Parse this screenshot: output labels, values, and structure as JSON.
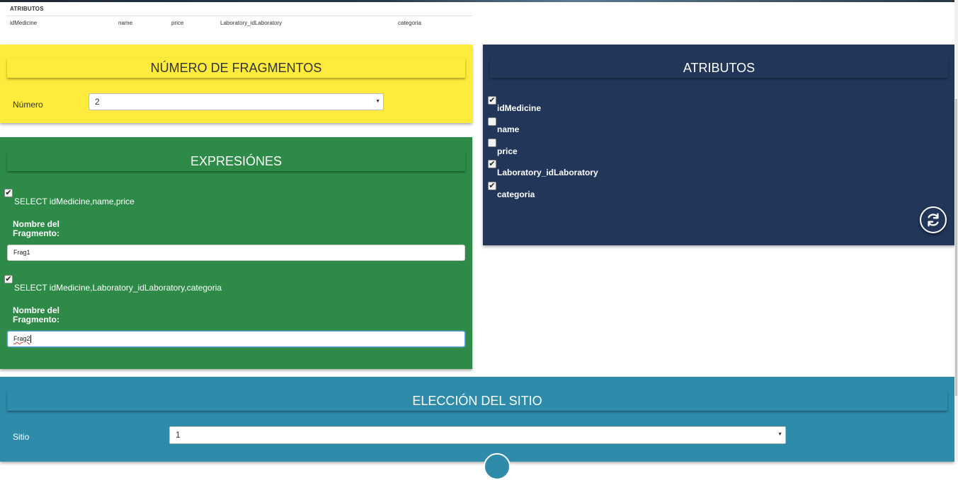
{
  "attributes_table": {
    "title": "ATRIBUTOS",
    "columns": [
      "idMedicine",
      "name",
      "price",
      "Laboratory_idLaboratory",
      "categoria"
    ]
  },
  "fragments_panel": {
    "title": "NÚMERO DE FRAGMENTOS",
    "number_label": "Número",
    "number_value": "2"
  },
  "expressions_panel": {
    "title": "EXPRESIÓNES",
    "expressions": [
      {
        "checked": true,
        "query": "SELECT idMedicine,name,price",
        "name_label_line1": "Nombre del",
        "name_label_line2": "Fragmento:",
        "fragment_name": "Frag1"
      },
      {
        "checked": true,
        "query": "SELECT idMedicine,Laboratory_idLaboratory,categoria",
        "name_label_line1": "Nombre del",
        "name_label_line2": "Fragmento:",
        "fragment_name": "Frag2"
      }
    ]
  },
  "attributes_panel": {
    "title": "ATRIBUTOS",
    "items": [
      {
        "label": "idMedicine",
        "checked": true
      },
      {
        "label": "name",
        "checked": false
      },
      {
        "label": "price",
        "checked": false
      },
      {
        "label": "Laboratory_idLaboratory",
        "checked": true
      },
      {
        "label": "categoria",
        "checked": true
      }
    ],
    "refresh_icon": "refresh-icon"
  },
  "site_panel": {
    "title": "ELECCIÓN DEL SITIO",
    "site_label": "Sitio",
    "site_value": "1"
  },
  "colors": {
    "yellow": "#ffeb3b",
    "green": "#2e8b47",
    "navy": "#22365a",
    "teal": "#2e8baa"
  }
}
